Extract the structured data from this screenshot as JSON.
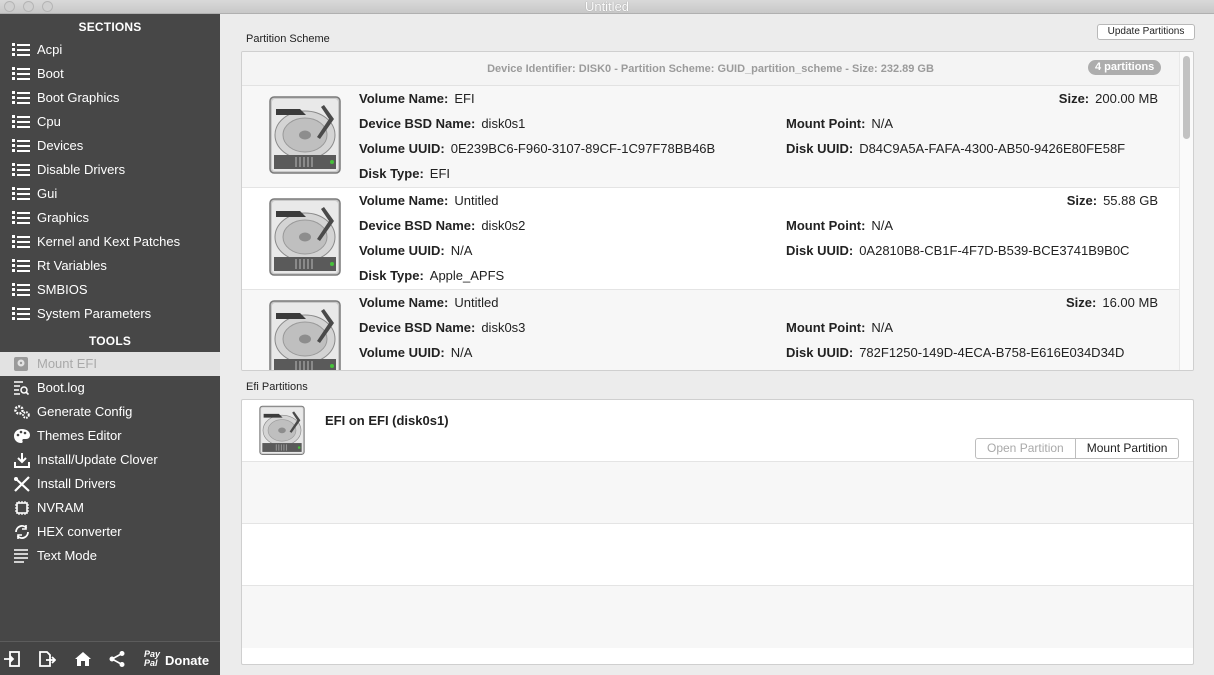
{
  "window": {
    "title": "Untitled"
  },
  "sidebar": {
    "sections_header": "SECTIONS",
    "sections": [
      "Acpi",
      "Boot",
      "Boot Graphics",
      "Cpu",
      "Devices",
      "Disable Drivers",
      "Gui",
      "Graphics",
      "Kernel and Kext Patches",
      "Rt Variables",
      "SMBIOS",
      "System Parameters"
    ],
    "tools_header": "TOOLS",
    "tools": [
      {
        "label": "Mount EFI",
        "icon": "mount-efi-icon",
        "selected": true
      },
      {
        "label": "Boot.log",
        "icon": "log-search-icon"
      },
      {
        "label": "Generate Config",
        "icon": "gears-icon"
      },
      {
        "label": "Themes Editor",
        "icon": "palette-icon"
      },
      {
        "label": "Install/Update Clover",
        "icon": "download-icon"
      },
      {
        "label": "Install Drivers",
        "icon": "tools-icon"
      },
      {
        "label": "NVRAM",
        "icon": "chip-icon"
      },
      {
        "label": "HEX converter",
        "icon": "refresh-icon"
      },
      {
        "label": "Text Mode",
        "icon": "text-lines-icon"
      }
    ],
    "footer": {
      "paypal": "Pay Pal",
      "donate": "Donate"
    }
  },
  "main": {
    "update_button": "Update Partitions",
    "partition_scheme": {
      "label": "Partition Scheme",
      "device_info": "Device Identifier: DISK0 - Partition Scheme: GUID_partition_scheme - Size: 232.89 GB",
      "badge": "4 partitions",
      "labels": {
        "volume_name": "Volume Name:",
        "device_bsd": "Device BSD Name:",
        "volume_uuid": "Volume UUID:",
        "disk_type": "Disk Type:",
        "size": "Size:",
        "mount_point": "Mount Point:",
        "disk_uuid": "Disk UUID:"
      },
      "partitions": [
        {
          "volume_name": "EFI",
          "device_bsd": "disk0s1",
          "volume_uuid": "0E239BC6-F960-3107-89CF-1C97F78BB46B",
          "disk_type": "EFI",
          "size": "200.00 MB",
          "mount_point": "N/A",
          "disk_uuid": "D84C9A5A-FAFA-4300-AB50-9426E80FE58F"
        },
        {
          "volume_name": "Untitled",
          "device_bsd": "disk0s2",
          "volume_uuid": "N/A",
          "disk_type": "Apple_APFS",
          "size": "55.88 GB",
          "mount_point": "N/A",
          "disk_uuid": "0A2810B8-CB1F-4F7D-B539-BCE3741B9B0C"
        },
        {
          "volume_name": "Untitled",
          "device_bsd": "disk0s3",
          "volume_uuid": "N/A",
          "disk_type": "",
          "size": "16.00 MB",
          "mount_point": "N/A",
          "disk_uuid": "782F1250-149D-4ECA-B758-E616E034D34D"
        }
      ]
    },
    "efi_partitions": {
      "label": "Efi Partitions",
      "items": [
        {
          "title": "EFI on EFI (disk0s1)",
          "open_button": "Open Partition",
          "mount_button": "Mount Partition"
        }
      ]
    }
  },
  "colors": {
    "sidebar_bg": "#474747",
    "selected_bg": "#e2e2e2",
    "badge_bg": "#adadad"
  }
}
